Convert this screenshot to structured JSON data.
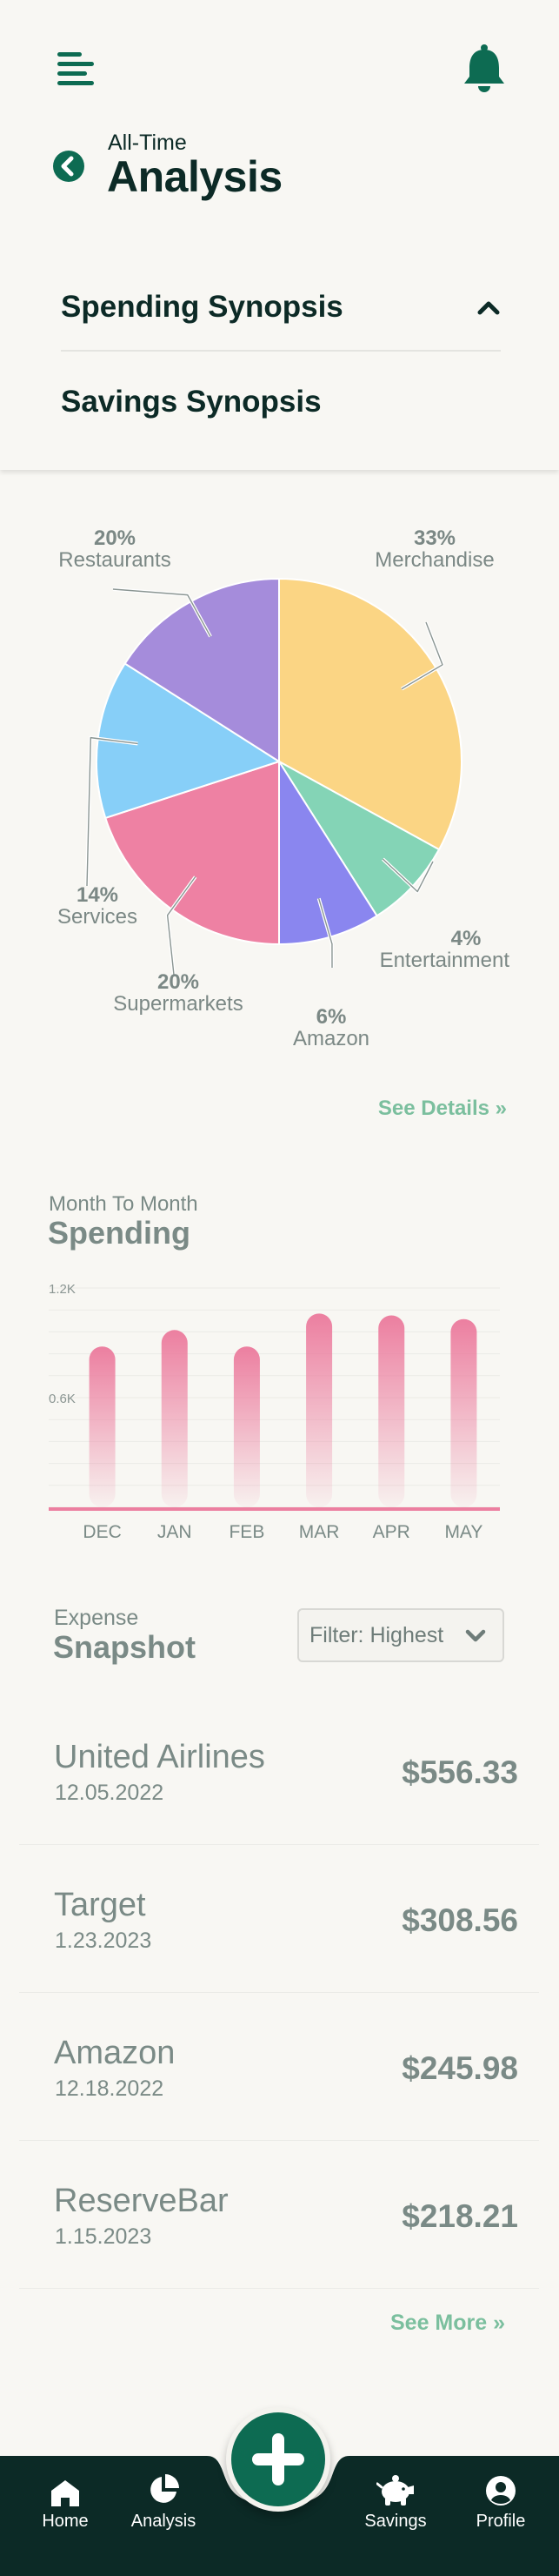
{
  "header": {
    "subtitle": "All-Time",
    "title": "Analysis"
  },
  "sections": [
    {
      "label": "Spending Synopsis",
      "expanded": true
    },
    {
      "label": "Savings Synopsis",
      "expanded": false
    }
  ],
  "colors": {
    "brand": "#0d6b52",
    "dark": "#0c2a26",
    "link": "#7bbf9e",
    "muted": "#7a8a86",
    "bar": "#ec7fa0"
  },
  "chart_data": [
    {
      "type": "pie",
      "slices": [
        {
          "name": "Merchandise",
          "pct_label": "33%",
          "value": 33,
          "color": "#fbd584"
        },
        {
          "name": "Entertainment",
          "pct_label": "4%",
          "value": 8,
          "color": "#84d4b6"
        },
        {
          "name": "Amazon",
          "pct_label": "6%",
          "value": 9,
          "color": "#8a86ef"
        },
        {
          "name": "Supermarkets",
          "pct_label": "20%",
          "value": 20,
          "color": "#ee81a3"
        },
        {
          "name": "Services",
          "pct_label": "14%",
          "value": 14,
          "color": "#87cff8"
        },
        {
          "name": "Restaurants",
          "pct_label": "20%",
          "value": 16,
          "color": "#a58cdb"
        }
      ]
    },
    {
      "type": "bar",
      "subtitle": "Month To Month",
      "title": "Spending",
      "categories": [
        "DEC",
        "JAN",
        "FEB",
        "MAR",
        "APR",
        "MAY"
      ],
      "values": [
        880,
        970,
        880,
        1060,
        1050,
        1030
      ],
      "ylim": [
        0,
        1200
      ],
      "yticks": [
        {
          "value": 1200,
          "label": "1.2K"
        },
        {
          "value": 600,
          "label": "0.6K"
        }
      ],
      "grid": true
    }
  ],
  "links": {
    "see_details": "See Details »",
    "see_more": "See More »"
  },
  "snapshot": {
    "subtitle": "Expense",
    "title": "Snapshot",
    "filter_label": "Filter: Highest",
    "items": [
      {
        "name": "United Airlines",
        "date": "12.05.2022",
        "amount": "$556.33"
      },
      {
        "name": "Target",
        "date": "1.23.2023",
        "amount": "$308.56"
      },
      {
        "name": "Amazon",
        "date": "12.18.2022",
        "amount": "$245.98"
      },
      {
        "name": "ReserveBar",
        "date": "1.15.2023",
        "amount": "$218.21"
      }
    ]
  },
  "nav": {
    "items": [
      {
        "label": "Home",
        "icon": "home-icon"
      },
      {
        "label": "Analysis",
        "icon": "pie-chart-icon"
      },
      {
        "label": "Savings",
        "icon": "piggy-bank-icon"
      },
      {
        "label": "Profile",
        "icon": "user-icon"
      }
    ],
    "fab_icon": "plus-icon"
  }
}
